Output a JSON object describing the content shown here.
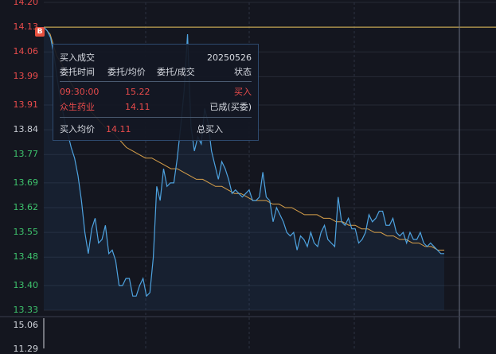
{
  "y_axis_labels": [
    {
      "value": "14.20",
      "color": "#e84b4b"
    },
    {
      "value": "14.13",
      "color": "#e84b4b"
    },
    {
      "value": "14.06",
      "color": "#e84b4b"
    },
    {
      "value": "13.99",
      "color": "#e84b4b"
    },
    {
      "value": "13.91",
      "color": "#e84b4b"
    },
    {
      "value": "13.84",
      "color": "#c8ccd4"
    },
    {
      "value": "13.77",
      "color": "#3ec46d"
    },
    {
      "value": "13.69",
      "color": "#3ec46d"
    },
    {
      "value": "13.62",
      "color": "#3ec46d"
    },
    {
      "value": "13.55",
      "color": "#3ec46d"
    },
    {
      "value": "13.48",
      "color": "#3ec46d"
    },
    {
      "value": "13.40",
      "color": "#3ec46d"
    },
    {
      "value": "13.33",
      "color": "#3ec46d"
    }
  ],
  "volume_axis": {
    "top_label": "15.06",
    "bottom_label": "11.29"
  },
  "buy_marker": {
    "letter": "B",
    "color": "#e8513f"
  },
  "reference_price": 14.13,
  "tooltip": {
    "title": "买入成交",
    "date": "20250526",
    "headers": [
      "委托时间",
      "委托/均价",
      "委托/成交",
      "状态"
    ],
    "order_time": "09:30:00",
    "order_price": "15.22",
    "order_status": "买入",
    "stock_name": "众生药业",
    "avg_price": "14.11",
    "fill_status": "已成(买委)",
    "summary_label": "买入均价",
    "summary_price": "14.11",
    "total_label": "总买入"
  },
  "chart_data": {
    "type": "line",
    "ylim": [
      13.33,
      14.2
    ],
    "series": [
      {
        "values": [
          14.13,
          14.11,
          14.05,
          14.02,
          13.98,
          13.95,
          13.93,
          13.9,
          13.88,
          13.86,
          13.84,
          13.83,
          13.81,
          13.79,
          13.78,
          13.77,
          13.76,
          13.76,
          13.75,
          13.74,
          13.73,
          13.73,
          13.72,
          13.71,
          13.7,
          13.7,
          13.69,
          13.68,
          13.68,
          13.67,
          13.66,
          13.66,
          13.65,
          13.64,
          13.64,
          13.64,
          13.63,
          13.63,
          13.62,
          13.62,
          13.61,
          13.6,
          13.6,
          13.6,
          13.59,
          13.59,
          13.58,
          13.58,
          13.57,
          13.57,
          13.56,
          13.56,
          13.55,
          13.55,
          13.54,
          13.54,
          13.53,
          13.53,
          13.52,
          13.52,
          13.51,
          13.51,
          13.5,
          13.5
        ]
      },
      {
        "values": [
          14.13,
          14.12,
          14.1,
          14.05,
          13.98,
          13.92,
          13.87,
          13.83,
          13.79,
          13.76,
          13.71,
          13.64,
          13.55,
          13.49,
          13.56,
          13.59,
          13.52,
          13.53,
          13.57,
          13.49,
          13.5,
          13.47,
          13.4,
          13.4,
          13.42,
          13.42,
          13.37,
          13.37,
          13.4,
          13.42,
          13.37,
          13.38,
          13.48,
          13.68,
          13.64,
          13.73,
          13.68,
          13.69,
          13.69,
          13.76,
          13.85,
          13.95,
          14.11,
          13.85,
          13.78,
          13.82,
          13.8,
          13.9,
          13.86,
          13.78,
          13.74,
          13.7,
          13.75,
          13.73,
          13.7,
          13.66,
          13.67,
          13.66,
          13.65,
          13.66,
          13.67,
          13.64,
          13.64,
          13.65,
          13.72,
          13.65,
          13.64,
          13.58,
          13.62,
          13.6,
          13.58,
          13.55,
          13.54,
          13.55,
          13.5,
          13.54,
          13.53,
          13.51,
          13.55,
          13.52,
          13.51,
          13.55,
          13.57,
          13.53,
          13.52,
          13.51,
          13.65,
          13.58,
          13.57,
          13.59,
          13.56,
          13.56,
          13.52,
          13.53,
          13.55,
          13.6,
          13.58,
          13.59,
          13.61,
          13.61,
          13.57,
          13.57,
          13.59,
          13.55,
          13.54,
          13.55,
          13.52,
          13.55,
          13.53,
          13.53,
          13.55,
          13.52,
          13.51,
          13.52,
          13.51,
          13.5,
          13.49,
          13.49
        ]
      }
    ]
  }
}
